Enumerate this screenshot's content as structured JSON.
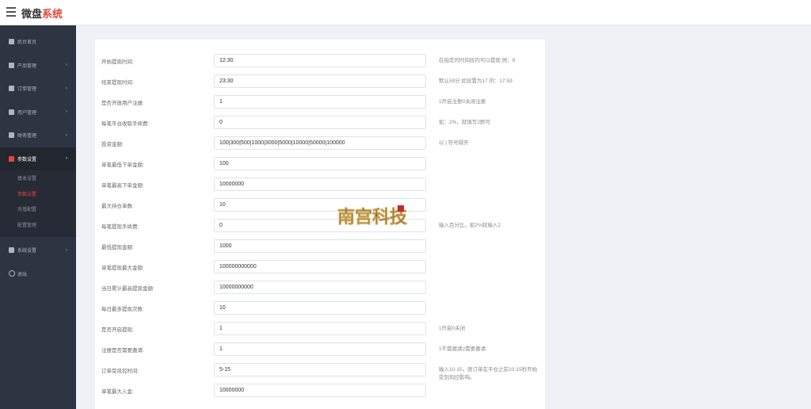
{
  "app": {
    "brand_part1": "微盘",
    "brand_part2": "系统"
  },
  "sidebar": {
    "items": [
      {
        "label": "后台首页",
        "icon": "dashboard-icon",
        "has_arrow": false
      },
      {
        "label": "产品管理",
        "icon": "bitcoin-icon",
        "has_arrow": true
      },
      {
        "label": "订单管理",
        "icon": "copy-icon",
        "has_arrow": true
      },
      {
        "label": "用户管理",
        "icon": "user-icon",
        "has_arrow": true
      },
      {
        "label": "财务管理",
        "icon": "yen-icon",
        "has_arrow": true
      },
      {
        "label": "参数设置",
        "icon": "settings-book-icon",
        "has_arrow": true,
        "active": true
      }
    ],
    "sub_items": [
      {
        "label": "基本设置"
      },
      {
        "label": "参数设置",
        "active": true
      },
      {
        "label": "充值配置"
      },
      {
        "label": "配置管理"
      }
    ],
    "bottom_items": [
      {
        "label": "系统设置",
        "icon": "cogs-icon",
        "has_arrow": true
      },
      {
        "label": "退出",
        "icon": "power-icon",
        "has_arrow": false
      }
    ]
  },
  "form": {
    "rows": [
      {
        "label": "开始提现时间:",
        "value": "12:30",
        "hint": "在指定的时间段内可以提现 例：9"
      },
      {
        "label": "结束提现时间:",
        "value": "23:30",
        "hint": "默认59分 如设置为17 的：17:59"
      },
      {
        "label": "是否开放用户注册:",
        "value": "1",
        "hint": "1开启注册0关闭注册"
      },
      {
        "label": "每笔平台收取手续费:",
        "value": "0",
        "hint": "如：2%，就填写2即可"
      },
      {
        "label": "投资金额:",
        "value": "100|300|500|1000|3000|5000|10000|50000|100000",
        "hint": "以 | 符号隔开"
      },
      {
        "label": "单笔最低下单金额:",
        "value": "100",
        "hint": ""
      },
      {
        "label": "单笔最高下单金额:",
        "value": "10000000",
        "hint": ""
      },
      {
        "label": "最大持仓单数:",
        "value": "10",
        "hint": ""
      },
      {
        "label": "每笔提现手续费:",
        "value": "0",
        "hint": "输入百分比，如2%就输入2"
      },
      {
        "label": "最低提现金额:",
        "value": "1000",
        "hint": ""
      },
      {
        "label": "单笔提现最大金额:",
        "value": "100000000000",
        "hint": ""
      },
      {
        "label": "当日累计最高提现金额:",
        "value": "10000000000",
        "hint": ""
      },
      {
        "label": "每日最多提现次数:",
        "value": "10",
        "hint": ""
      },
      {
        "label": "是否开启提现:",
        "value": "1",
        "hint": "1开启0关闭"
      },
      {
        "label": "注册是否需要邀请:",
        "value": "1",
        "hint": "1不需邀请2需要邀请"
      },
      {
        "label": "订单受风控时间:",
        "value": "5-15",
        "hint": "输入10-15，则订单在平仓之前10-15秒开始受到风控影响。"
      },
      {
        "label": "单笔最大入金:",
        "value": "10000000",
        "hint": ""
      }
    ]
  },
  "watermark": {
    "text": "南宫科技",
    "color": "#1a1a1a",
    "accent": "#c8282a"
  },
  "colors": {
    "accent": "#e2463a",
    "sidebar_bg": "#2f3442"
  }
}
